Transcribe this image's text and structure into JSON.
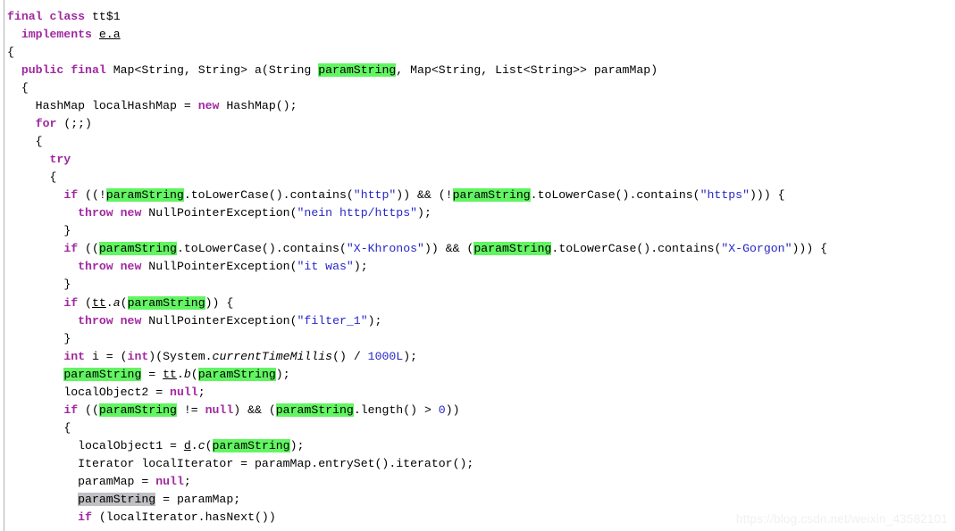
{
  "editor": {
    "language": "java",
    "search_term": "paramString",
    "colors": {
      "keyword": "#a128a1",
      "string": "#2727c8",
      "number": "#2727c8",
      "identifier": "#000000",
      "background": "#ffffff",
      "match_highlight": "#62f562",
      "current_match_highlight": "#c0c0c4",
      "gutter_rule": "#b0b0b6",
      "watermark": "#f0f0f0"
    }
  },
  "watermark": {
    "text": "https://blog.csdn.net/weixin_43582101"
  },
  "code": {
    "plain_text": "final class tt$1\n  implements e.a\n{\n  public final Map<String, String> a(String paramString, Map<String, List<String>> paramMap)\n  {\n    HashMap localHashMap = new HashMap();\n    for (;;)\n    {\n      try\n      {\n        if ((!paramString.toLowerCase().contains(\"http\")) && (!paramString.toLowerCase().contains(\"https\"))) {\n          throw new NullPointerException(\"nein http/https\");\n        }\n        if ((paramString.toLowerCase().contains(\"X-Khronos\")) && (paramString.toLowerCase().contains(\"X-Gorgon\"))) {\n          throw new NullPointerException(\"it was\");\n        }\n        if (tt.a(paramString)) {\n          throw new NullPointerException(\"filter_1\");\n        }\n        int i = (int)(System.currentTimeMillis() / 1000L);\n        paramString = tt.b(paramString);\n        localObject2 = null;\n        if ((paramString != null) && (paramString.length() > 0))\n        {\n          localObject1 = d.c(paramString);\n          Iterator localIterator = paramMap.entrySet().iterator();\n          paramMap = null;\n          paramString = paramMap;\n          if (localIterator.hasNext())",
    "lines": [
      {
        "indent": 0,
        "tokens": [
          {
            "text": "final",
            "style": "t-kw"
          },
          {
            "text": " ",
            "style": "t-punct"
          },
          {
            "text": "class",
            "style": "t-kw"
          },
          {
            "text": " ",
            "style": "t-punct"
          },
          {
            "text": "tt$1",
            "style": "t-id"
          }
        ]
      },
      {
        "indent": 2,
        "tokens": [
          {
            "text": "implements",
            "style": "t-kw"
          },
          {
            "text": " ",
            "style": "t-punct"
          },
          {
            "text": "e.a",
            "style": "t-cls"
          }
        ]
      },
      {
        "indent": 0,
        "tokens": [
          {
            "text": "{",
            "style": "t-punct"
          }
        ]
      },
      {
        "indent": 2,
        "tokens": [
          {
            "text": "public",
            "style": "t-kw"
          },
          {
            "text": " ",
            "style": "t-punct"
          },
          {
            "text": "final",
            "style": "t-kw"
          },
          {
            "text": " ",
            "style": "t-punct"
          },
          {
            "text": "Map<String, String> a(String ",
            "style": "t-id"
          },
          {
            "text": "paramString",
            "style": "t-id",
            "highlight": "match"
          },
          {
            "text": ", Map<String, List<String>> paramMap)",
            "style": "t-id"
          }
        ]
      },
      {
        "indent": 2,
        "tokens": [
          {
            "text": "{",
            "style": "t-punct"
          }
        ]
      },
      {
        "indent": 4,
        "tokens": [
          {
            "text": "HashMap localHashMap = ",
            "style": "t-id"
          },
          {
            "text": "new",
            "style": "t-kw"
          },
          {
            "text": " HashMap();",
            "style": "t-id"
          }
        ]
      },
      {
        "indent": 4,
        "tokens": [
          {
            "text": "for",
            "style": "t-kw"
          },
          {
            "text": " (;;)",
            "style": "t-id"
          }
        ]
      },
      {
        "indent": 4,
        "tokens": [
          {
            "text": "{",
            "style": "t-punct"
          }
        ]
      },
      {
        "indent": 6,
        "tokens": [
          {
            "text": "try",
            "style": "t-kw"
          }
        ]
      },
      {
        "indent": 6,
        "tokens": [
          {
            "text": "{",
            "style": "t-punct"
          }
        ]
      },
      {
        "indent": 8,
        "tokens": [
          {
            "text": "if",
            "style": "t-kw"
          },
          {
            "text": " ((!",
            "style": "t-id"
          },
          {
            "text": "paramString",
            "style": "t-id",
            "highlight": "match"
          },
          {
            "text": ".toLowerCase().contains(",
            "style": "t-id"
          },
          {
            "text": "\"http\"",
            "style": "t-str"
          },
          {
            "text": ")) && (!",
            "style": "t-id"
          },
          {
            "text": "paramString",
            "style": "t-id",
            "highlight": "match"
          },
          {
            "text": ".toLowerCase().contains(",
            "style": "t-id"
          },
          {
            "text": "\"https\"",
            "style": "t-str"
          },
          {
            "text": "))) {",
            "style": "t-id"
          }
        ]
      },
      {
        "indent": 10,
        "tokens": [
          {
            "text": "throw",
            "style": "t-kw"
          },
          {
            "text": " ",
            "style": "t-punct"
          },
          {
            "text": "new",
            "style": "t-kw"
          },
          {
            "text": " NullPointerException(",
            "style": "t-id"
          },
          {
            "text": "\"nein http/https\"",
            "style": "t-str"
          },
          {
            "text": ");",
            "style": "t-id"
          }
        ]
      },
      {
        "indent": 8,
        "tokens": [
          {
            "text": "}",
            "style": "t-punct"
          }
        ]
      },
      {
        "indent": 8,
        "tokens": [
          {
            "text": "if",
            "style": "t-kw"
          },
          {
            "text": " ((",
            "style": "t-id"
          },
          {
            "text": "paramString",
            "style": "t-id",
            "highlight": "match"
          },
          {
            "text": ".toLowerCase().contains(",
            "style": "t-id"
          },
          {
            "text": "\"X-Khronos\"",
            "style": "t-str"
          },
          {
            "text": ")) && (",
            "style": "t-id"
          },
          {
            "text": "paramString",
            "style": "t-id",
            "highlight": "match"
          },
          {
            "text": ".toLowerCase().contains(",
            "style": "t-id"
          },
          {
            "text": "\"X-Gorgon\"",
            "style": "t-str"
          },
          {
            "text": "))) {",
            "style": "t-id"
          }
        ]
      },
      {
        "indent": 10,
        "tokens": [
          {
            "text": "throw",
            "style": "t-kw"
          },
          {
            "text": " ",
            "style": "t-punct"
          },
          {
            "text": "new",
            "style": "t-kw"
          },
          {
            "text": " NullPointerException(",
            "style": "t-id"
          },
          {
            "text": "\"it was\"",
            "style": "t-str"
          },
          {
            "text": ");",
            "style": "t-id"
          }
        ]
      },
      {
        "indent": 8,
        "tokens": [
          {
            "text": "}",
            "style": "t-punct"
          }
        ]
      },
      {
        "indent": 8,
        "tokens": [
          {
            "text": "if",
            "style": "t-kw"
          },
          {
            "text": " (",
            "style": "t-id"
          },
          {
            "text": "tt",
            "style": "t-cls"
          },
          {
            "text": ".",
            "style": "t-id"
          },
          {
            "text": "a",
            "style": "t-mth"
          },
          {
            "text": "(",
            "style": "t-id"
          },
          {
            "text": "paramString",
            "style": "t-id",
            "highlight": "match"
          },
          {
            "text": ")) {",
            "style": "t-id"
          }
        ]
      },
      {
        "indent": 10,
        "tokens": [
          {
            "text": "throw",
            "style": "t-kw"
          },
          {
            "text": " ",
            "style": "t-punct"
          },
          {
            "text": "new",
            "style": "t-kw"
          },
          {
            "text": " NullPointerException(",
            "style": "t-id"
          },
          {
            "text": "\"filter_1\"",
            "style": "t-str"
          },
          {
            "text": ");",
            "style": "t-id"
          }
        ]
      },
      {
        "indent": 8,
        "tokens": [
          {
            "text": "}",
            "style": "t-punct"
          }
        ]
      },
      {
        "indent": 8,
        "tokens": [
          {
            "text": "int",
            "style": "t-kw"
          },
          {
            "text": " i = (",
            "style": "t-id"
          },
          {
            "text": "int",
            "style": "t-kw"
          },
          {
            "text": ")(System.",
            "style": "t-id"
          },
          {
            "text": "currentTimeMillis",
            "style": "t-mth"
          },
          {
            "text": "() / ",
            "style": "t-id"
          },
          {
            "text": "1000L",
            "style": "t-num"
          },
          {
            "text": ");",
            "style": "t-id"
          }
        ]
      },
      {
        "indent": 8,
        "tokens": [
          {
            "text": "paramString",
            "style": "t-id",
            "highlight": "match"
          },
          {
            "text": " = ",
            "style": "t-id"
          },
          {
            "text": "tt",
            "style": "t-cls"
          },
          {
            "text": ".",
            "style": "t-id"
          },
          {
            "text": "b",
            "style": "t-mth"
          },
          {
            "text": "(",
            "style": "t-id"
          },
          {
            "text": "paramString",
            "style": "t-id",
            "highlight": "match"
          },
          {
            "text": ");",
            "style": "t-id"
          }
        ]
      },
      {
        "indent": 8,
        "tokens": [
          {
            "text": "localObject2 = ",
            "style": "t-id"
          },
          {
            "text": "null",
            "style": "t-kw"
          },
          {
            "text": ";",
            "style": "t-id"
          }
        ]
      },
      {
        "indent": 8,
        "tokens": [
          {
            "text": "if",
            "style": "t-kw"
          },
          {
            "text": " ((",
            "style": "t-id"
          },
          {
            "text": "paramString",
            "style": "t-id",
            "highlight": "match"
          },
          {
            "text": " != ",
            "style": "t-id"
          },
          {
            "text": "null",
            "style": "t-kw"
          },
          {
            "text": ") && (",
            "style": "t-id"
          },
          {
            "text": "paramString",
            "style": "t-id",
            "highlight": "match"
          },
          {
            "text": ".length() > ",
            "style": "t-id"
          },
          {
            "text": "0",
            "style": "t-num"
          },
          {
            "text": "))",
            "style": "t-id"
          }
        ]
      },
      {
        "indent": 8,
        "tokens": [
          {
            "text": "{",
            "style": "t-punct"
          }
        ]
      },
      {
        "indent": 10,
        "tokens": [
          {
            "text": "localObject1 = ",
            "style": "t-id"
          },
          {
            "text": "d",
            "style": "t-cls"
          },
          {
            "text": ".",
            "style": "t-id"
          },
          {
            "text": "c",
            "style": "t-mth"
          },
          {
            "text": "(",
            "style": "t-id"
          },
          {
            "text": "paramString",
            "style": "t-id",
            "highlight": "match"
          },
          {
            "text": ");",
            "style": "t-id"
          }
        ]
      },
      {
        "indent": 10,
        "tokens": [
          {
            "text": "Iterator localIterator = paramMap.entrySet().iterator();",
            "style": "t-id"
          }
        ]
      },
      {
        "indent": 10,
        "tokens": [
          {
            "text": "paramMap = ",
            "style": "t-id"
          },
          {
            "text": "null",
            "style": "t-kw"
          },
          {
            "text": ";",
            "style": "t-id"
          }
        ]
      },
      {
        "indent": 10,
        "tokens": [
          {
            "text": "paramString",
            "style": "t-id",
            "highlight": "current"
          },
          {
            "text": " = paramMap;",
            "style": "t-id"
          }
        ]
      },
      {
        "indent": 10,
        "tokens": [
          {
            "text": "if",
            "style": "t-kw"
          },
          {
            "text": " (localIterator.hasNext())",
            "style": "t-id"
          }
        ]
      }
    ]
  }
}
